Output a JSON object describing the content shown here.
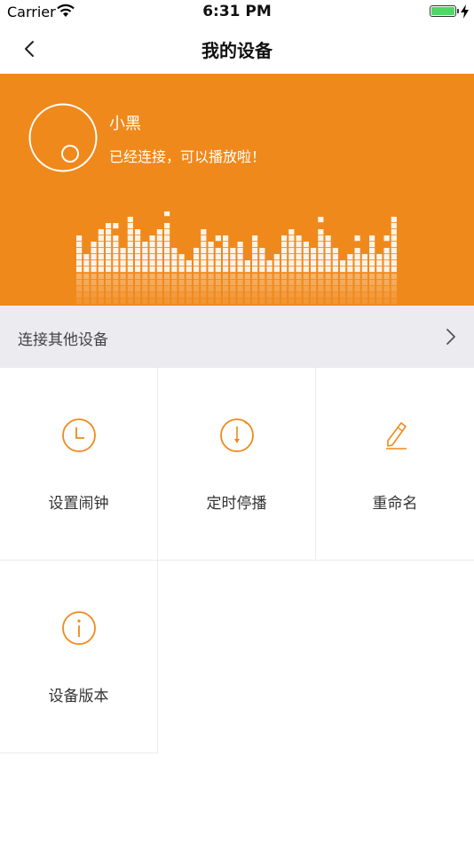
{
  "status_bar": {
    "carrier": "Carrier",
    "time": "6:31 PM",
    "battery_level": 1.0,
    "battery_color": "#4cd964"
  },
  "nav": {
    "title": "我的设备",
    "back_icon": "chevron-left-icon"
  },
  "device": {
    "name": "小黑",
    "status": "已经连接，可以播放啦！",
    "avatar_icon": "device-circle-icon",
    "hero_color": "#f0891b"
  },
  "connect_other": {
    "label": "连接其他设备",
    "icon": "chevron-right-icon"
  },
  "actions": [
    {
      "label": "设置闹钟",
      "icon": "clock-icon"
    },
    {
      "label": "定时停播",
      "icon": "timer-icon"
    },
    {
      "label": "重命名",
      "icon": "pencil-icon"
    },
    {
      "label": "设备版本",
      "icon": "info-icon"
    }
  ],
  "accent_color": "#f0891b"
}
